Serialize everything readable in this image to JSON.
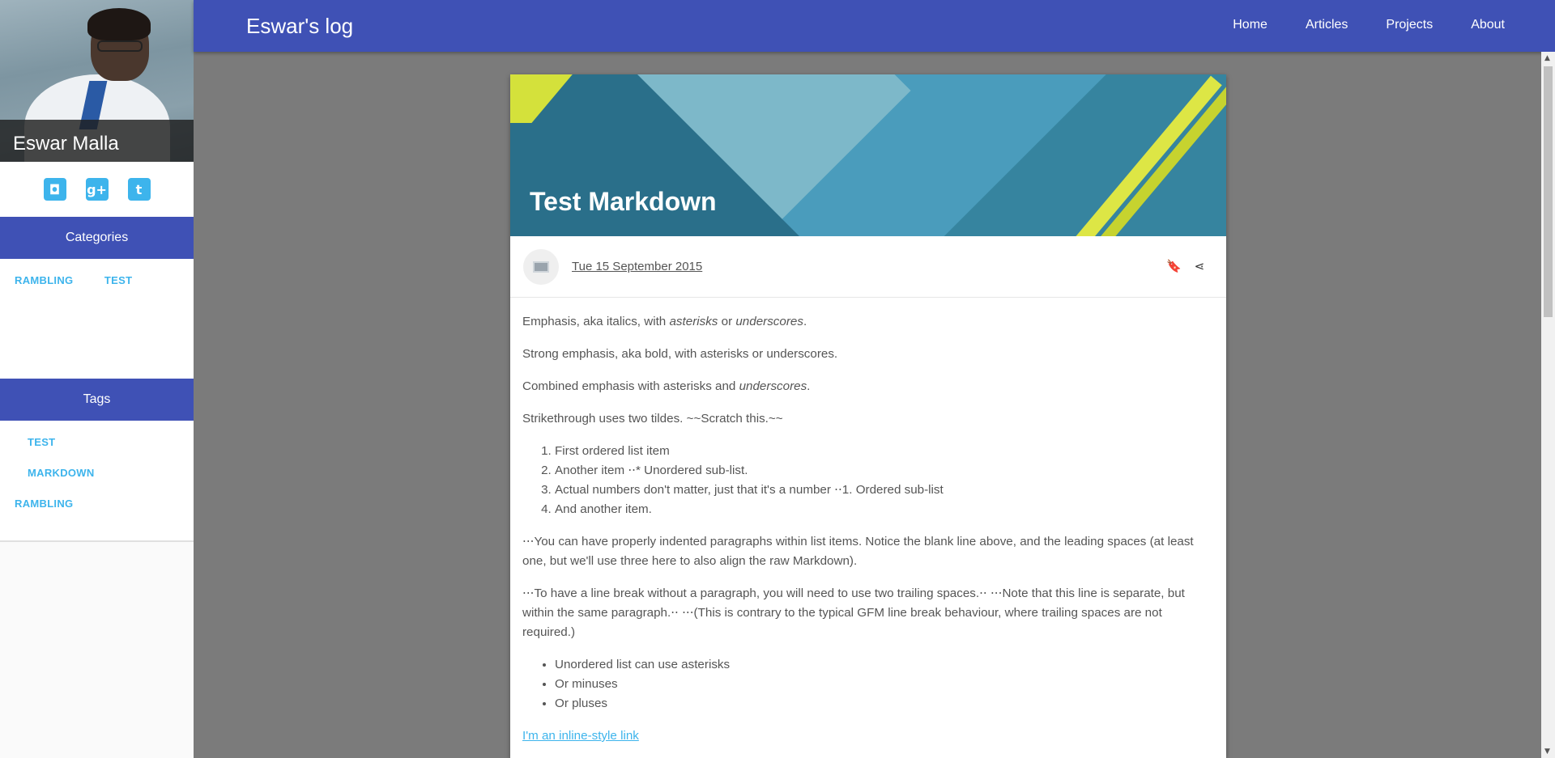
{
  "profile": {
    "name": "Eswar Malla"
  },
  "social": [
    {
      "icon": "github-icon",
      "glyph": "◘"
    },
    {
      "icon": "google-plus-icon",
      "glyph": "g+"
    },
    {
      "icon": "twitter-icon",
      "glyph": "t"
    }
  ],
  "categories": {
    "title": "Categories",
    "items": [
      "RAMBLING",
      "TEST"
    ]
  },
  "tags": {
    "title": "Tags",
    "items": [
      "TEST",
      "MARKDOWN",
      "RAMBLING"
    ]
  },
  "header": {
    "title": "Eswar's log",
    "nav": [
      "Home",
      "Articles",
      "Projects",
      "About"
    ]
  },
  "post": {
    "title": "Test Markdown",
    "date": "Tue 15 September 2015",
    "p1": "Emphasis, aka italics, with ",
    "p1_em1": "asterisks",
    "p1_mid": " or ",
    "p1_em2": "underscores",
    "p1_end": ".",
    "p2": "Strong emphasis, aka bold, with asterisks or underscores.",
    "p3": "Combined emphasis with asterisks and ",
    "p3_em": "underscores",
    "p3_end": ".",
    "p4": "Strikethrough uses two tildes. ~~Scratch this.~~",
    "ordered": [
      "First ordered list item",
      "Another item ⋅⋅* Unordered sub-list.",
      "Actual numbers don't matter, just that it's a number ⋅⋅1. Ordered sub-list",
      "And another item."
    ],
    "p5": "⋅⋅⋅You can have properly indented paragraphs within list items. Notice the blank line above, and the leading spaces (at least one, but we'll use three here to also align the raw Markdown).",
    "p6": "⋅⋅⋅To have a line break without a paragraph, you will need to use two trailing spaces.⋅⋅ ⋅⋅⋅Note that this line is separate, but within the same paragraph.⋅⋅ ⋅⋅⋅(This is contrary to the typical GFM line break behaviour, where trailing spaces are not required.)",
    "unordered": [
      "Unordered list can use asterisks",
      "Or minuses",
      "Or pluses"
    ],
    "link": "I'm an inline-style link"
  }
}
